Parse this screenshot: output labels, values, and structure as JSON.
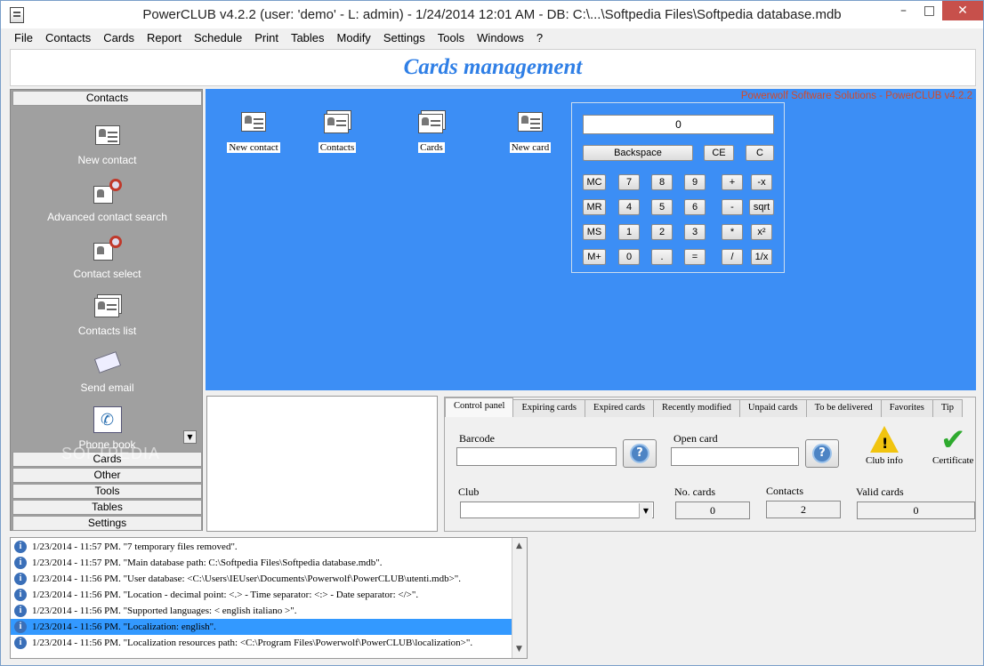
{
  "titlebar": {
    "title": "PowerCLUB v4.2.2  (user: 'demo'  - L: admin) - 1/24/2014 12:01 AM - DB: C:\\...\\Softpedia Files\\Softpedia database.mdb",
    "minimize": "–",
    "maximize": "□",
    "close": "✕"
  },
  "menu": [
    "File",
    "Contacts",
    "Cards",
    "Report",
    "Schedule",
    "Print",
    "Tables",
    "Modify",
    "Settings",
    "Tools",
    "Windows",
    "?"
  ],
  "header": {
    "title": "Cards management"
  },
  "sidebar": {
    "active_group": "Contacts",
    "items": [
      {
        "label": "New contact",
        "icon": "contact-card-icon"
      },
      {
        "label": "Advanced contact search",
        "icon": "contact-search-icon"
      },
      {
        "label": "Contact select",
        "icon": "contact-select-icon"
      },
      {
        "label": "Contacts list",
        "icon": "contacts-list-icon"
      },
      {
        "label": "Send email",
        "icon": "envelope-icon"
      },
      {
        "label": "Phone book",
        "icon": "phone-book-icon"
      }
    ],
    "groups": [
      "Cards",
      "Other",
      "Tools",
      "Tables",
      "Settings"
    ],
    "watermark": "SOFTPEDIA"
  },
  "main": {
    "brand": "Powerwolf Software Solutions - PowerCLUB v4.2.2",
    "shortcuts": [
      {
        "label": "New contact"
      },
      {
        "label": "Contacts"
      },
      {
        "label": "Cards"
      },
      {
        "label": "New card"
      }
    ]
  },
  "calculator": {
    "display": "0",
    "backspace": "Backspace",
    "ce": "CE",
    "c": "C",
    "rows": [
      [
        "MC",
        "7",
        "8",
        "9",
        "+",
        "-x"
      ],
      [
        "MR",
        "4",
        "5",
        "6",
        "-",
        "sqrt"
      ],
      [
        "MS",
        "1",
        "2",
        "3",
        "*",
        "x²"
      ],
      [
        "M+",
        "0",
        ".",
        "=",
        "/",
        "1/x"
      ]
    ]
  },
  "tabs": {
    "items": [
      "Control panel",
      "Expiring cards",
      "Expired cards",
      "Recently modified",
      "Unpaid cards",
      "To be delivered",
      "Favorites",
      "Tip"
    ],
    "active": "Control panel"
  },
  "control_panel": {
    "barcode_label": "Barcode",
    "barcode_value": "",
    "open_card_label": "Open card",
    "open_card_value": "",
    "club_info_label": "Club info",
    "certificate_label": "Certificate",
    "club_label": "Club",
    "club_value": "",
    "no_cards_label": "No. cards",
    "no_cards_value": "0",
    "contacts_label": "Contacts",
    "contacts_value": "2",
    "valid_cards_label": "Valid cards",
    "valid_cards_value": "0"
  },
  "log": {
    "selected_index": 5,
    "rows": [
      "1/23/2014 - 11:57 PM. \"7 temporary files removed\".",
      "1/23/2014 - 11:57 PM. \"Main database path: C:\\Softpedia Files\\Softpedia database.mdb\".",
      "1/23/2014 - 11:56 PM. \"User database: <C:\\Users\\IEUser\\Documents\\Powerwolf\\PowerCLUB\\utenti.mdb>\".",
      "1/23/2014 - 11:56 PM. \"Location - decimal point: <.> - Time separator: <:> - Date separator: </>\".",
      "1/23/2014 - 11:56 PM. \"Supported languages: < english italiano >\".",
      "1/23/2014 - 11:56 PM. \"Localization: english\".",
      "1/23/2014 - 11:56 PM. \"Localization resources path: <C:\\Program Files\\Powerwolf\\PowerCLUB\\localization>\"."
    ]
  }
}
